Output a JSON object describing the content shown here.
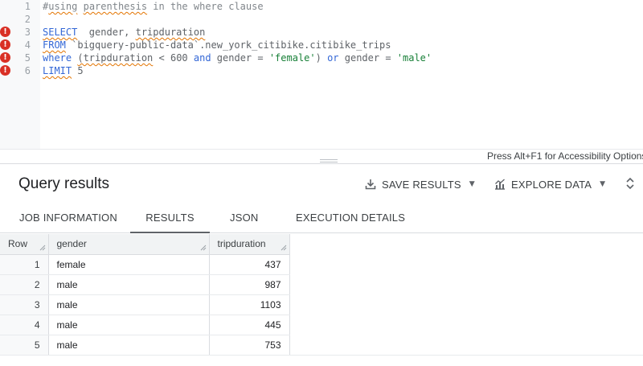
{
  "editor": {
    "lines": [
      {
        "num": "1",
        "error": false,
        "parts": [
          {
            "t": "#",
            "c": "cmt"
          },
          {
            "t": "using",
            "c": "cmt squiggle"
          },
          {
            "t": " ",
            "c": "cmt"
          },
          {
            "t": "parenthesis",
            "c": "cmt squiggle"
          },
          {
            "t": " in the where clause",
            "c": "cmt"
          }
        ]
      },
      {
        "num": "2",
        "error": false,
        "parts": []
      },
      {
        "num": "3",
        "error": true,
        "parts": [
          {
            "t": "SELECT",
            "c": "kw squiggle"
          },
          {
            "t": "  gender, ",
            "c": ""
          },
          {
            "t": "tripduration",
            "c": "squiggle"
          }
        ]
      },
      {
        "num": "4",
        "error": true,
        "parts": [
          {
            "t": "FROM",
            "c": "kw squiggle"
          },
          {
            "t": " `bigquery-public-data`.new_york_citibike.citibike_trips",
            "c": ""
          }
        ]
      },
      {
        "num": "5",
        "error": true,
        "parts": [
          {
            "t": "where ",
            "c": "kw"
          },
          {
            "t": "(tripduration",
            "c": "squiggle"
          },
          {
            "t": " < ",
            "c": ""
          },
          {
            "t": "600",
            "c": "num"
          },
          {
            "t": " ",
            "c": ""
          },
          {
            "t": "and",
            "c": "kw"
          },
          {
            "t": " gender = ",
            "c": ""
          },
          {
            "t": "'female'",
            "c": "str"
          },
          {
            "t": ") ",
            "c": ""
          },
          {
            "t": "or",
            "c": "kw"
          },
          {
            "t": " gender = ",
            "c": ""
          },
          {
            "t": "'male'",
            "c": "str"
          }
        ]
      },
      {
        "num": "6",
        "error": true,
        "parts": [
          {
            "t": "LIMIT",
            "c": "kw squiggle"
          },
          {
            "t": " ",
            "c": ""
          },
          {
            "t": "5",
            "c": "num"
          }
        ]
      }
    ],
    "error_glyph": "!",
    "a11y_hint": "Press Alt+F1 for Accessibility Options"
  },
  "results": {
    "title": "Query results",
    "save_results_label": "SAVE RESULTS",
    "explore_data_label": "EXPLORE DATA",
    "caret": "▼"
  },
  "tabs": [
    {
      "label": "JOB INFORMATION",
      "active": false
    },
    {
      "label": "RESULTS",
      "active": true
    },
    {
      "label": "JSON",
      "active": false
    },
    {
      "label": "EXECUTION DETAILS",
      "active": false
    }
  ],
  "table": {
    "headers": [
      "Row",
      "gender",
      "tripduration"
    ],
    "rows": [
      {
        "row": "1",
        "gender": "female",
        "tripduration": "437"
      },
      {
        "row": "2",
        "gender": "male",
        "tripduration": "987"
      },
      {
        "row": "3",
        "gender": "male",
        "tripduration": "1103"
      },
      {
        "row": "4",
        "gender": "male",
        "tripduration": "445"
      },
      {
        "row": "5",
        "gender": "male",
        "tripduration": "753"
      }
    ]
  },
  "colors": {
    "error_red": "#d93025",
    "keyword_blue": "#3367d6",
    "string_green": "#188038",
    "squiggle_orange": "#e37400"
  }
}
